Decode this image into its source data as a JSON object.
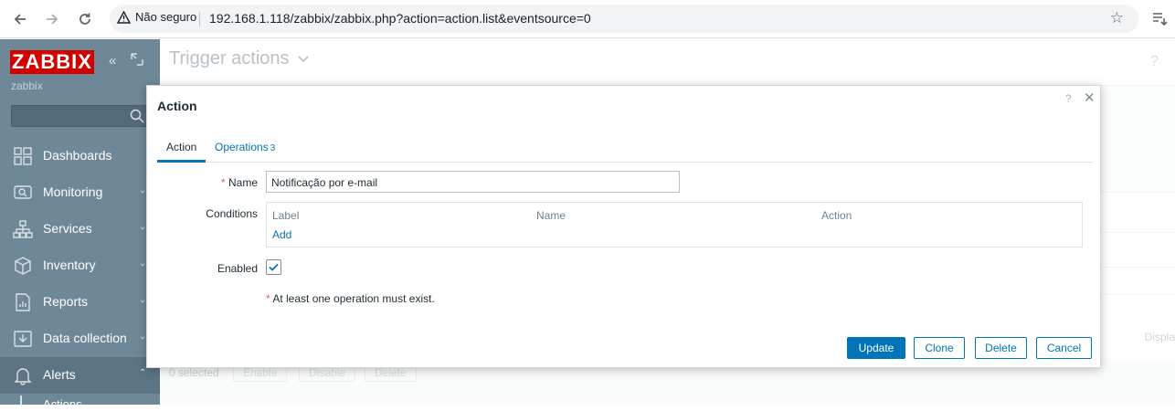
{
  "browser": {
    "security_label": "Não seguro",
    "url": "192.168.1.118/zabbix/zabbix.php?action=action.list&eventsource=0"
  },
  "sidebar": {
    "logo": "ZABBIX",
    "server_name": "zabbix",
    "items": [
      {
        "label": "Dashboards"
      },
      {
        "label": "Monitoring",
        "arrow": "⌄"
      },
      {
        "label": "Services",
        "arrow": "⌄"
      },
      {
        "label": "Inventory",
        "arrow": "⌄"
      },
      {
        "label": "Reports",
        "arrow": "⌄"
      },
      {
        "label": "Data collection",
        "arrow": "⌄"
      },
      {
        "label": "Alerts",
        "arrow": "⌃"
      }
    ],
    "sub_item": "Actions"
  },
  "main": {
    "title": "Trigger actions",
    "help": "?",
    "displa_text": "Displa",
    "selected_text": "0 selected",
    "bulk_buttons": [
      "Enable",
      "Disable",
      "Delete"
    ]
  },
  "modal": {
    "title": "Action",
    "help": "?",
    "tabs": {
      "action": "Action",
      "operations": "Operations",
      "operations_count": "3"
    },
    "form": {
      "name_required": "*",
      "name_label": "Name",
      "name_value": "Notificação por e-mail",
      "conditions_label": "Conditions",
      "conditions_headers": [
        "Label",
        "Name",
        "Action"
      ],
      "conditions_add": "Add",
      "enabled_label": "Enabled",
      "enabled_checked": true,
      "note_required": "*",
      "note": "At least one operation must exist."
    },
    "buttons": {
      "update": "Update",
      "clone": "Clone",
      "delete": "Delete",
      "cancel": "Cancel"
    }
  }
}
